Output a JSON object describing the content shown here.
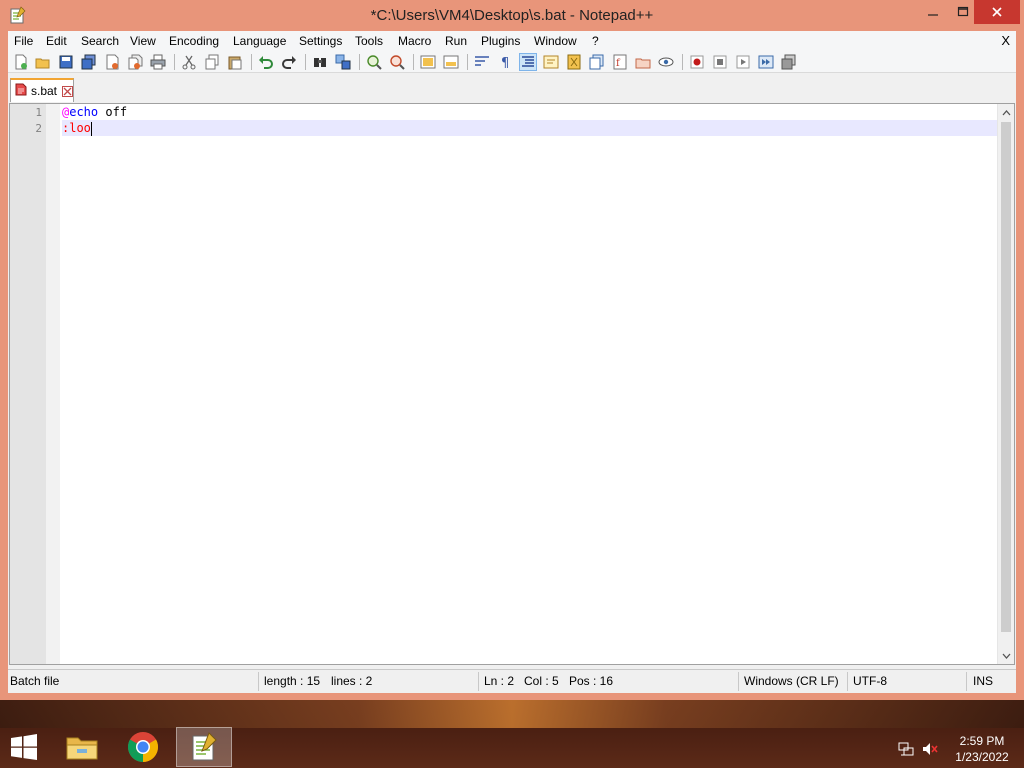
{
  "window": {
    "title": "*C:\\Users\\VM4\\Desktop\\s.bat - Notepad++",
    "menu_close": "X"
  },
  "menu": [
    "File",
    "Edit",
    "Search",
    "View",
    "Encoding",
    "Language",
    "Settings",
    "Tools",
    "Macro",
    "Run",
    "Plugins",
    "Window",
    "?"
  ],
  "tab": {
    "label": "s.bat"
  },
  "editor": {
    "line_numbers": [
      "1",
      "2"
    ],
    "line1": {
      "at": "@",
      "cmd": "echo",
      "rest": " off"
    },
    "line2": {
      "label": ":loo"
    }
  },
  "status": {
    "file_type": "Batch file",
    "length": "length : 15",
    "lines": "lines : 2",
    "ln": "Ln : 2",
    "col": "Col : 5",
    "pos": "Pos : 16",
    "eol": "Windows (CR LF)",
    "encoding": "UTF-8",
    "mode": "INS"
  },
  "taskbar": {
    "time": "2:59 PM",
    "date": "1/23/2022"
  },
  "colors": {
    "accent": "#e8957a",
    "tab_highlight": "#f2a533",
    "current_line": "#e8e8ff"
  }
}
